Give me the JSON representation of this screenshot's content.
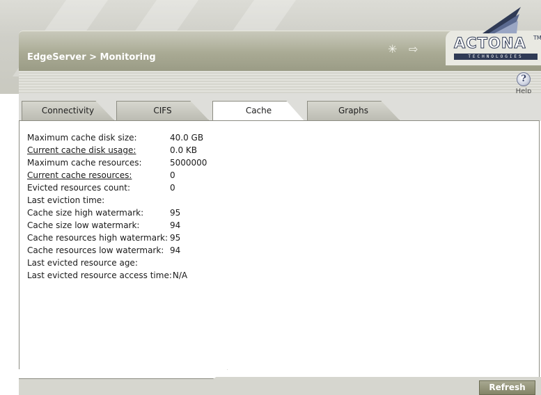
{
  "header": {
    "title": "EdgeServer > Monitoring",
    "logo_text": "ACTONA",
    "logo_tm": "TM",
    "logo_sub": "TECHNOLOGIES"
  },
  "toolbar": {
    "help_icon_glyph": "?",
    "help_label": "Help"
  },
  "tabs": [
    {
      "label": "Connectivity"
    },
    {
      "label": "CIFS"
    },
    {
      "label": "Cache"
    },
    {
      "label": "Graphs"
    }
  ],
  "active_tab": "Cache",
  "cache_info": [
    {
      "label": "Maximum cache disk size:",
      "value": "40.0 GB"
    },
    {
      "label": "Current cache disk usage:",
      "value": "0.0 KB"
    },
    {
      "label": "Maximum cache resources:",
      "value": "5000000"
    },
    {
      "label": "Current cache resources:",
      "value": "0"
    },
    {
      "label": "Evicted resources count:",
      "value": "0"
    },
    {
      "label": "Last eviction time:",
      "value": ""
    },
    {
      "label": "Cache size high watermark:",
      "value": "95"
    },
    {
      "label": "Cache size low watermark:",
      "value": "94"
    },
    {
      "label": "Cache resources high watermark:",
      "value": "95"
    },
    {
      "label": "Cache resources low watermark:",
      "value": "94"
    },
    {
      "label": "Last evicted resource age:",
      "value": ""
    },
    {
      "label": "Last evicted resource access time:",
      "value": "N/A"
    }
  ],
  "footer": {
    "refresh_label": "Refresh"
  },
  "colors": {
    "header_bar": "#a9aa94",
    "brand_navy": "#2f3a55",
    "refresh_button": "#838467"
  }
}
